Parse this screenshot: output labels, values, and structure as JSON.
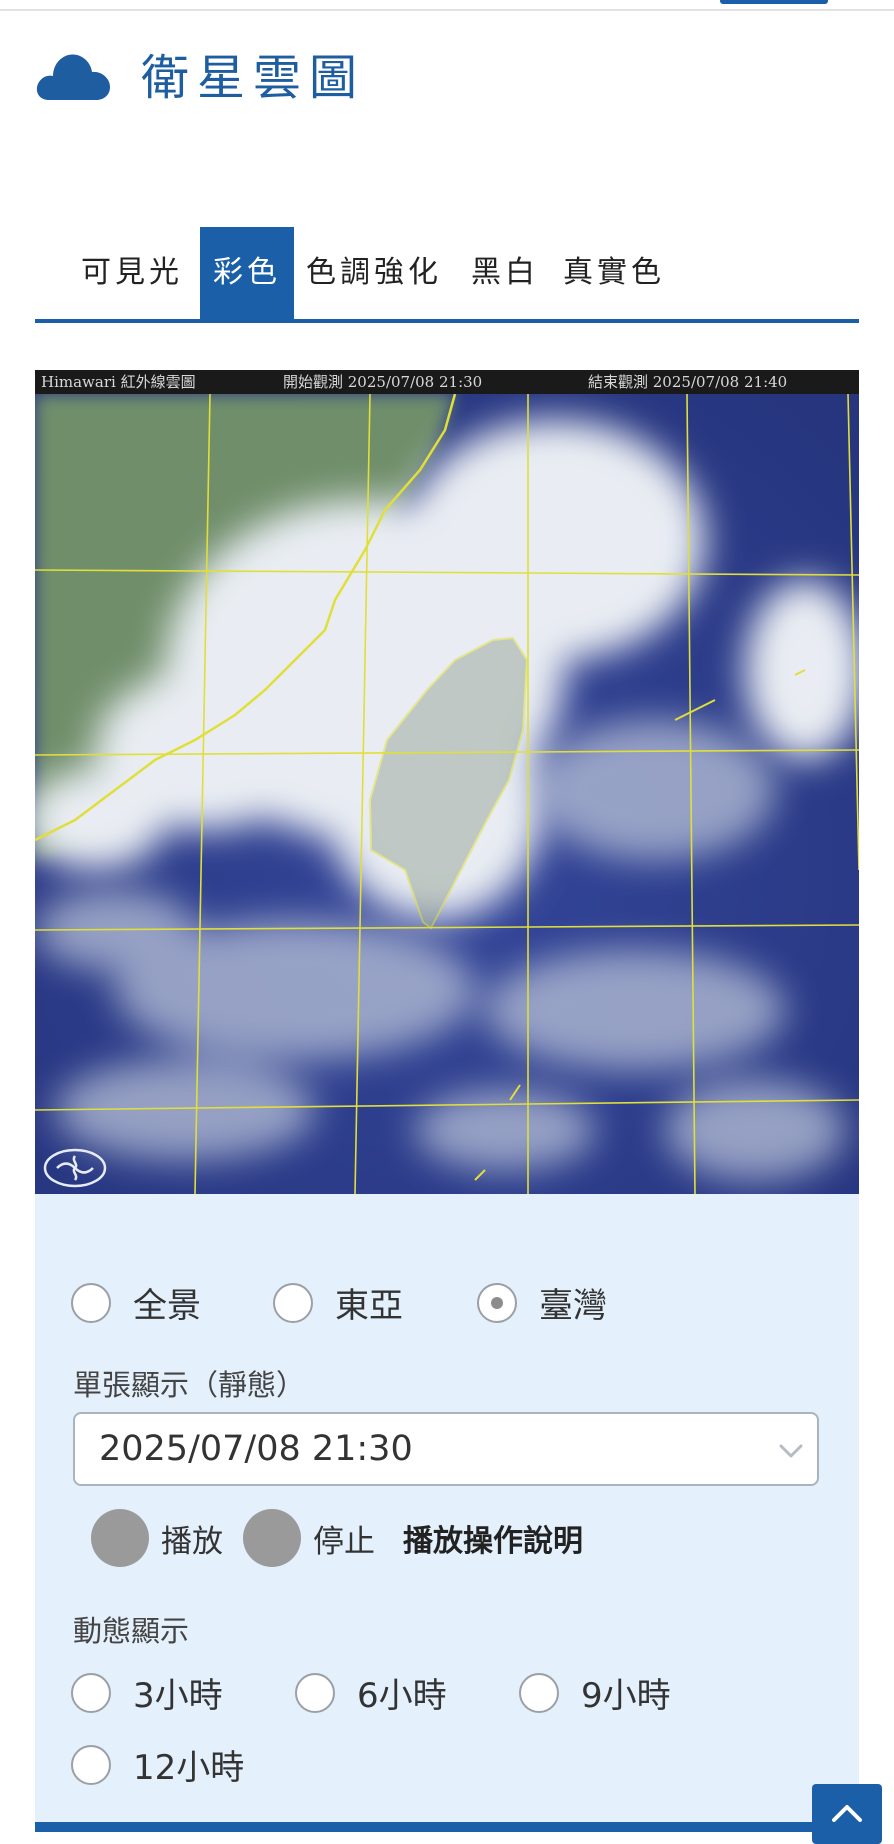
{
  "header": {
    "title": "衛星雲圖",
    "icon": "cloud-icon",
    "accent_color": "#1a5fa8"
  },
  "tabs": [
    {
      "label": "可見光",
      "active": false
    },
    {
      "label": "彩色",
      "active": true
    },
    {
      "label": "色調強化",
      "active": false
    },
    {
      "label": "黑白",
      "active": false
    },
    {
      "label": "真實色",
      "active": false
    }
  ],
  "image": {
    "header_left": "Himawari 紅外線雲圖",
    "header_start": "開始觀測 2025/07/08 21:30",
    "header_end": "結束觀測 2025/07/08 21:40",
    "logo_icon": "cwa-logo-icon"
  },
  "region": {
    "options": [
      "全景",
      "東亞",
      "臺灣"
    ],
    "selected": "臺灣"
  },
  "static_display": {
    "label": "單張顯示（靜態）",
    "selected_time": "2025/07/08 21:30"
  },
  "playback": {
    "play_label": "播放",
    "stop_label": "停止",
    "help_label": "播放操作說明"
  },
  "dynamic_display": {
    "label": "動態顯示",
    "options": [
      "3小時",
      "6小時",
      "9小時",
      "12小時"
    ]
  },
  "back_to_top_icon": "chevron-up-icon"
}
